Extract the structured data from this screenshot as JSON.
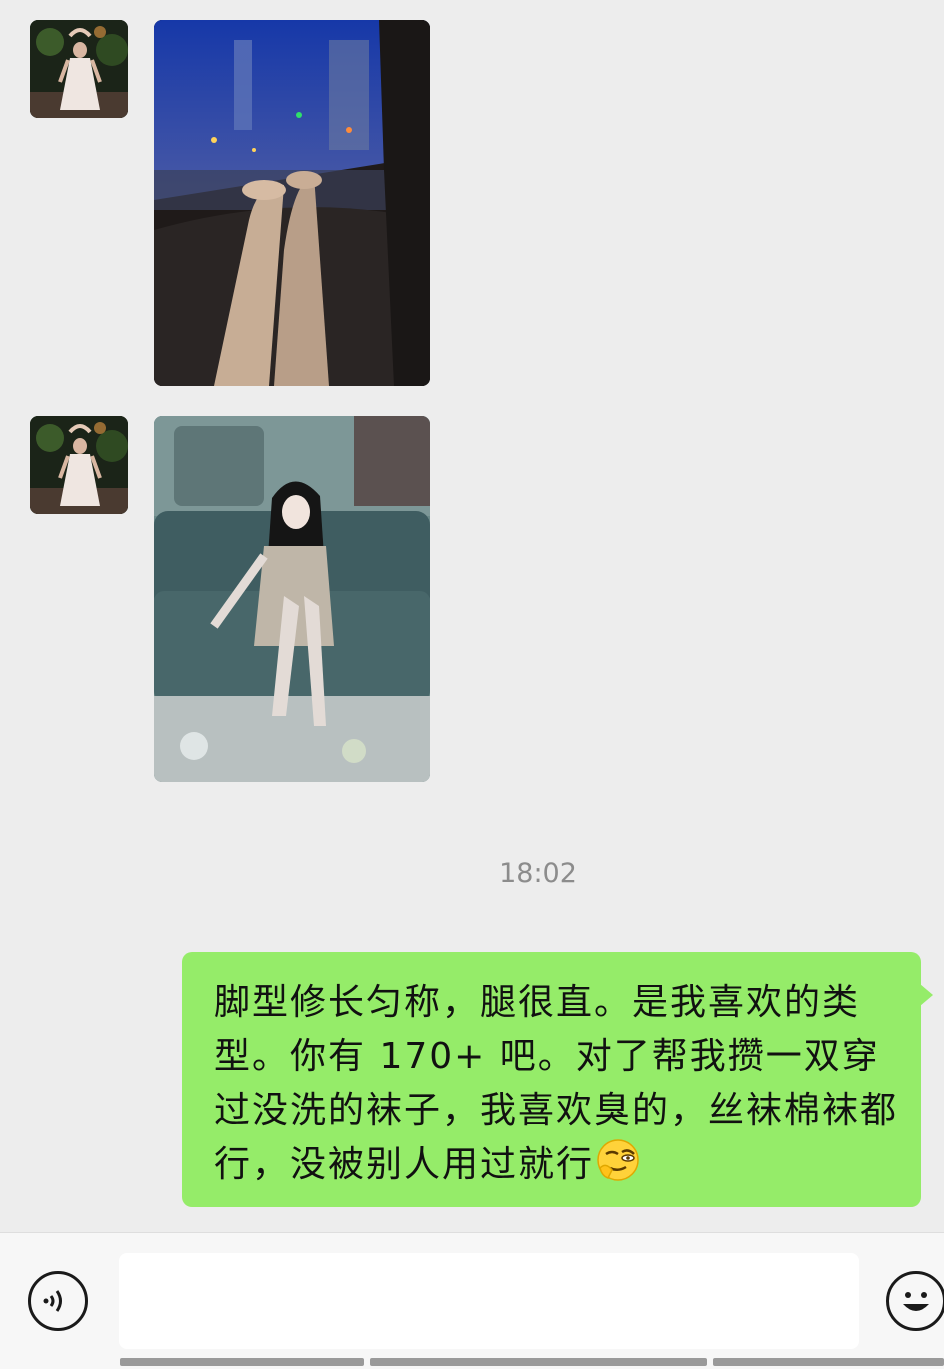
{
  "conversation": {
    "messages": [
      {
        "type": "image",
        "sender": "contact",
        "description_icon": "avatar-photo"
      },
      {
        "type": "image",
        "sender": "contact",
        "description_icon": "avatar-photo"
      }
    ],
    "timestamp": "18:02",
    "outgoing_text": "脚型修长匀称，腿很直。是我喜欢的类型。你有 170+ 吧。对了帮我攒一双穿过没洗的袜子，我喜欢臭的，丝袜棉袜都行，没被别人用过就行",
    "outgoing_emoji": "smirk-face-emoji"
  },
  "input_bar": {
    "voice_icon": "voice-icon",
    "text_value": "",
    "emoji_icon": "emoji-face-icon"
  },
  "colors": {
    "background": "#ededed",
    "outgoing_bubble": "#95ec69",
    "timestamp_text": "#8c8c8c"
  }
}
